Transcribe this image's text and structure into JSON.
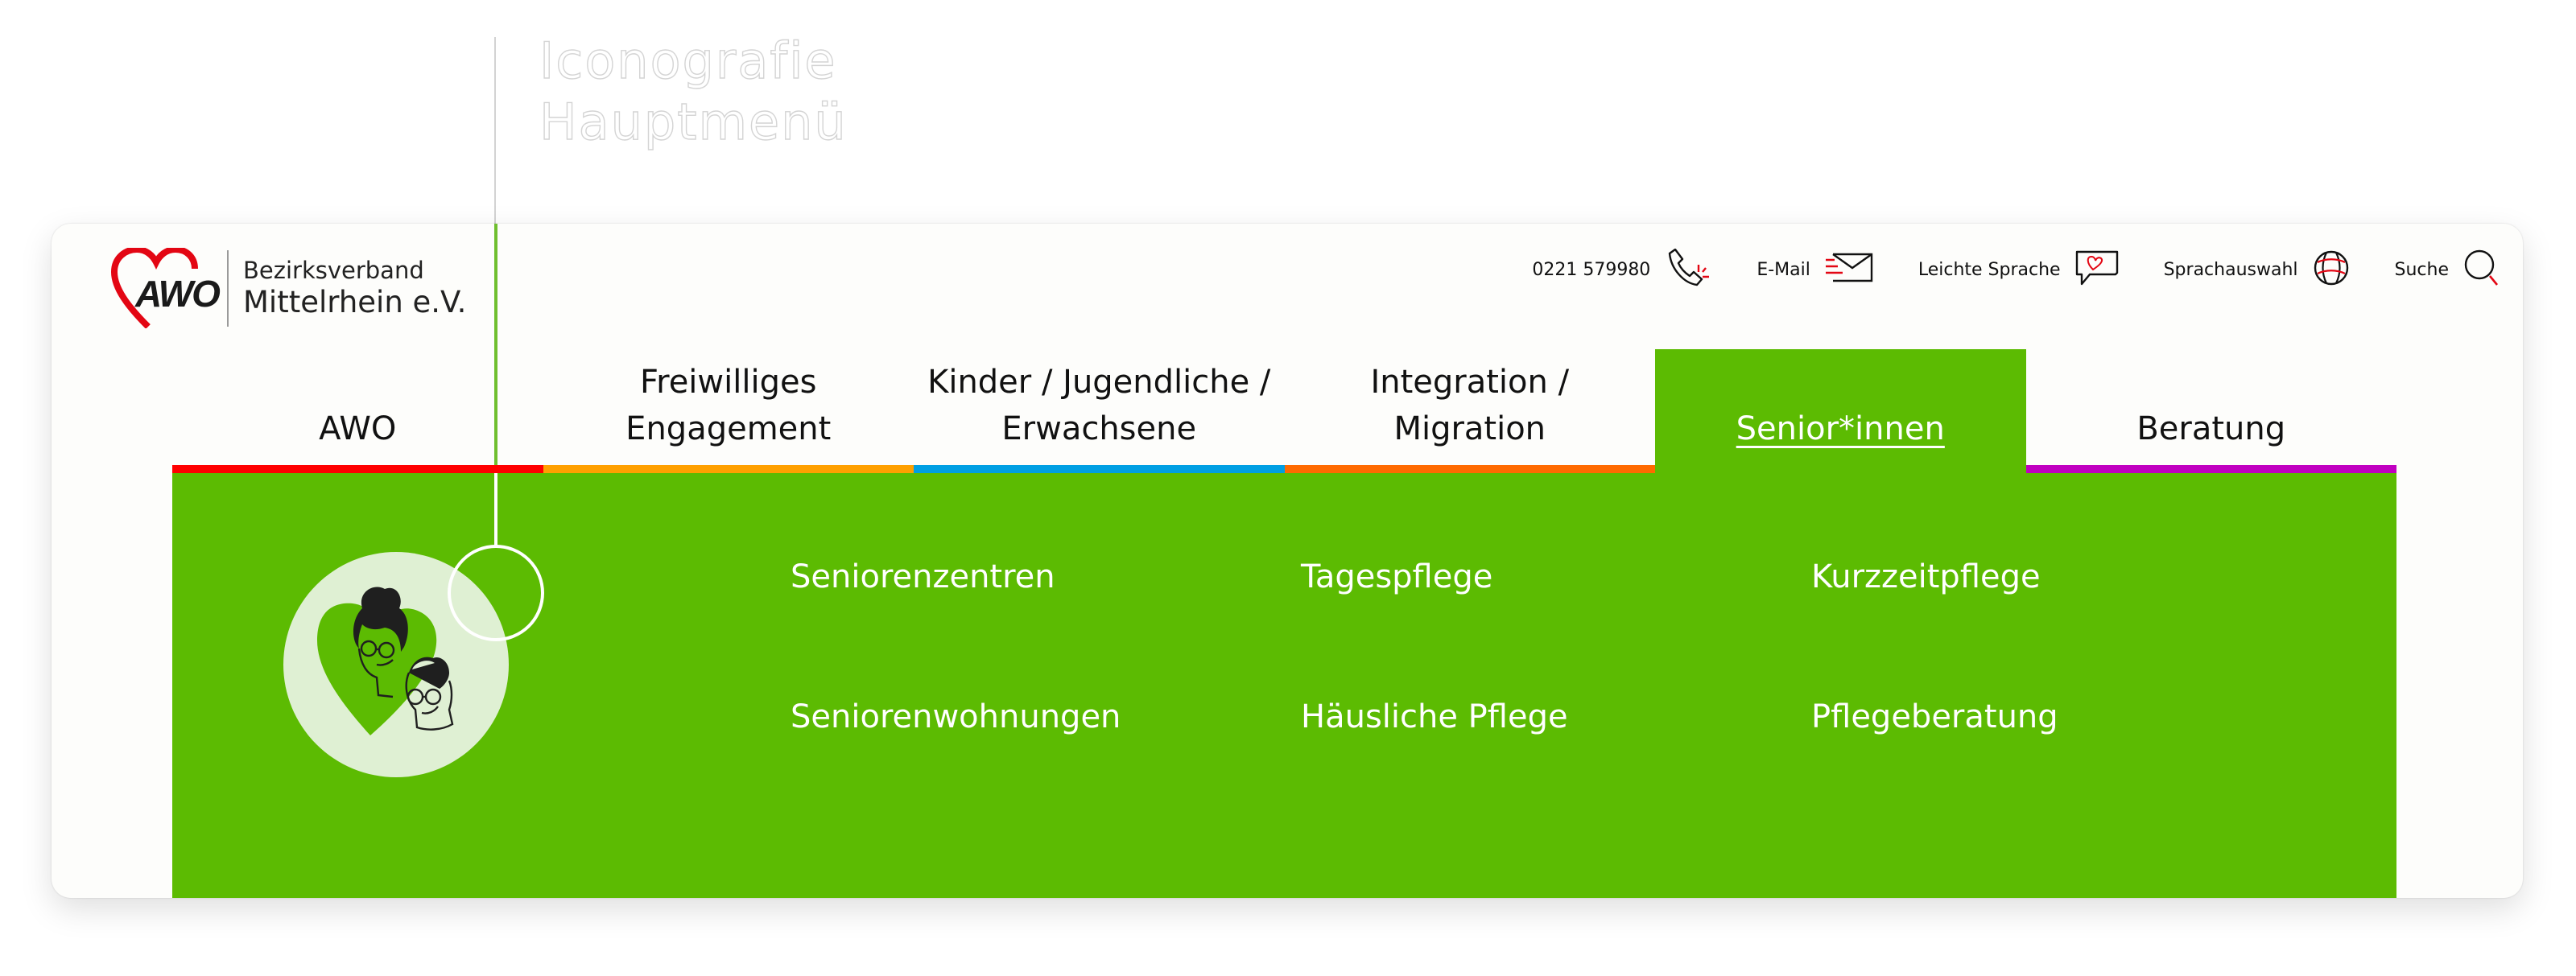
{
  "annotation": {
    "title_line1": "Iconografie",
    "title_line2": "Hauptmenü"
  },
  "logo": {
    "mark": "AWO",
    "line1": "Bezirksverband",
    "line2": "Mittelrhein e.V."
  },
  "utility": [
    {
      "label": "0221 579980",
      "icon": "phone-icon"
    },
    {
      "label": "E-Mail",
      "icon": "mail-icon"
    },
    {
      "label": "Leichte Sprache",
      "icon": "speech-bubble-heart-icon"
    },
    {
      "label": "Sprachauswahl",
      "icon": "globe-icon"
    },
    {
      "label": "Suche",
      "icon": "search-icon"
    }
  ],
  "nav": {
    "items": [
      {
        "label": "AWO",
        "color": "#ff0000",
        "active": false
      },
      {
        "label": "Freiwilliges\nEngagement",
        "color": "#ffa000",
        "active": false
      },
      {
        "label": "Kinder / Jugendliche /\nErwachsene",
        "color": "#009fe3",
        "active": false
      },
      {
        "label": "Integration /\nMigration",
        "color": "#ff6a00",
        "active": false
      },
      {
        "label": "Senior*innen",
        "color": "#5cbb02",
        "active": true
      },
      {
        "label": "Beratung",
        "color": "#c000c0",
        "active": false
      }
    ]
  },
  "panel": {
    "icon": "seniors-couple-heart-icon",
    "links": [
      "Seniorenzentren",
      "Tagespflege",
      "Kurzzeitpflege",
      "Seniorenwohnungen",
      "Häusliche Pflege",
      "Pflegeberatung"
    ]
  },
  "colors": {
    "accent_green": "#5cbb02",
    "brand_red": "#e30613"
  }
}
